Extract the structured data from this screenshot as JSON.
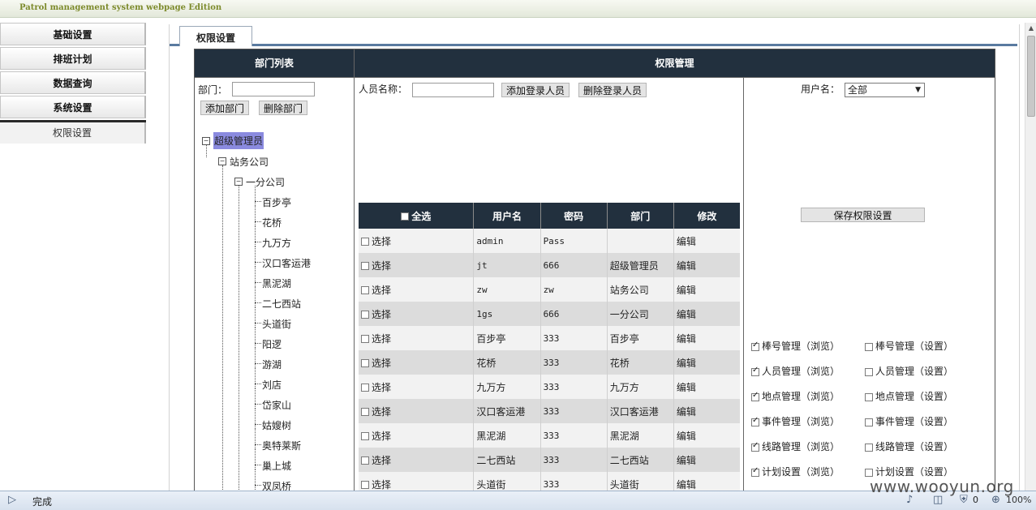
{
  "app_title": "Patrol management system webpage Edition",
  "nav": {
    "items": [
      "基础设置",
      "排班计划",
      "数据查询",
      "系统设置"
    ],
    "sub_item": "权限设置"
  },
  "tab": "权限设置",
  "dept_panel": {
    "header": "部门列表",
    "dept_label": "部门：",
    "add_button": "添加部门",
    "delete_button": "删除部门",
    "tree": {
      "root": "超级管理员",
      "level1": "站务公司",
      "level2": "一分公司",
      "leaves": [
        "百步亭",
        "花桥",
        "九万方",
        "汉口客运港",
        "黑泥湖",
        "二七西站",
        "头道街",
        "阳逻",
        "游湖",
        "刘店",
        "岱家山",
        "姑嫂树",
        "奥特莱斯",
        "巢上城",
        "双凤桥"
      ]
    }
  },
  "perm_panel": {
    "header": "权限管理",
    "person_label": "人员名称：",
    "add_login_button": "添加登录人员",
    "delete_login_button": "删除登录人员",
    "username_label": "用户名：",
    "username_select": "全部",
    "save_button": "保存权限设置",
    "grid": {
      "headers": [
        "全选",
        "用户名",
        "密码",
        "部门",
        "修改"
      ],
      "select_label": "选择",
      "edit_label": "编辑",
      "rows": [
        {
          "user": "admin",
          "pwd": "Pass",
          "dept": ""
        },
        {
          "user": "jt",
          "pwd": "666",
          "dept": "超级管理员"
        },
        {
          "user": "zw",
          "pwd": "zw",
          "dept": "站务公司"
        },
        {
          "user": "1gs",
          "pwd": "666",
          "dept": "一分公司"
        },
        {
          "user": "百步亭",
          "pwd": "333",
          "dept": "百步亭"
        },
        {
          "user": "花桥",
          "pwd": "333",
          "dept": "花桥"
        },
        {
          "user": "九万方",
          "pwd": "333",
          "dept": "九万方"
        },
        {
          "user": "汉口客运港",
          "pwd": "333",
          "dept": "汉口客运港"
        },
        {
          "user": "黑泥湖",
          "pwd": "333",
          "dept": "黑泥湖"
        },
        {
          "user": "二七西站",
          "pwd": "333",
          "dept": "二七西站"
        },
        {
          "user": "头道街",
          "pwd": "333",
          "dept": "头道街"
        }
      ]
    },
    "permissions": [
      {
        "browse": "棒号管理（浏览）",
        "browse_checked": true,
        "set": "棒号管理（设置）",
        "set_checked": false
      },
      {
        "browse": "人员管理（浏览）",
        "browse_checked": true,
        "set": "人员管理（设置）",
        "set_checked": false
      },
      {
        "browse": "地点管理（浏览）",
        "browse_checked": true,
        "set": "地点管理（设置）",
        "set_checked": false
      },
      {
        "browse": "事件管理（浏览）",
        "browse_checked": true,
        "set": "事件管理（设置）",
        "set_checked": false
      },
      {
        "browse": "线路管理（浏览）",
        "browse_checked": true,
        "set": "线路管理（设置）",
        "set_checked": false
      },
      {
        "browse": "计划设置（浏览）",
        "browse_checked": true,
        "set": "计划设置（设置）",
        "set_checked": false
      }
    ]
  },
  "status": {
    "text": "完成",
    "counter": "0",
    "zoom": "100%"
  },
  "watermark": "www.wooyun.org"
}
